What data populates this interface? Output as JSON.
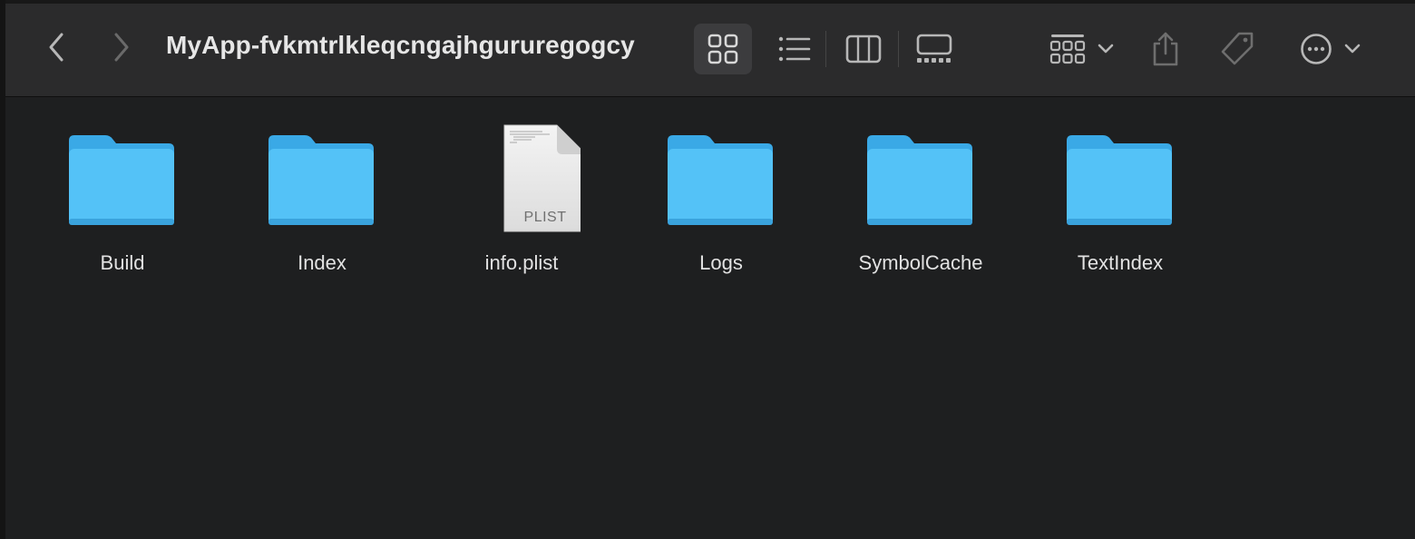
{
  "window": {
    "title": "MyApp-fvkmtrlkleqcngajhgururegogcy"
  },
  "toolbar": {
    "back": {
      "icon": "chevron-left-icon"
    },
    "forward": {
      "icon": "chevron-right-icon"
    },
    "views": [
      {
        "name": "icon-view",
        "icon": "grid-icon",
        "selected": true
      },
      {
        "name": "list-view",
        "icon": "list-icon",
        "selected": false
      },
      {
        "name": "column-view",
        "icon": "columns-icon",
        "selected": false
      },
      {
        "name": "gallery-view",
        "icon": "gallery-icon",
        "selected": false
      }
    ],
    "group": {
      "icon": "group-grid-icon"
    },
    "share": {
      "icon": "share-icon"
    },
    "tag": {
      "icon": "tag-icon"
    },
    "more": {
      "icon": "ellipsis-circle-icon"
    }
  },
  "files": [
    {
      "name": "Build",
      "kind": "folder"
    },
    {
      "name": "Index",
      "kind": "folder"
    },
    {
      "name": "info.plist",
      "kind": "document",
      "badge": "PLIST"
    },
    {
      "name": "Logs",
      "kind": "folder"
    },
    {
      "name": "SymbolCache",
      "kind": "folder"
    },
    {
      "name": "TextIndex",
      "kind": "folder"
    }
  ],
  "colors": {
    "folder_body": "#54c2f7",
    "folder_tab": "#3aa9e6",
    "toolbar_bg": "#2b2b2c",
    "content_bg": "#1e1f20"
  }
}
